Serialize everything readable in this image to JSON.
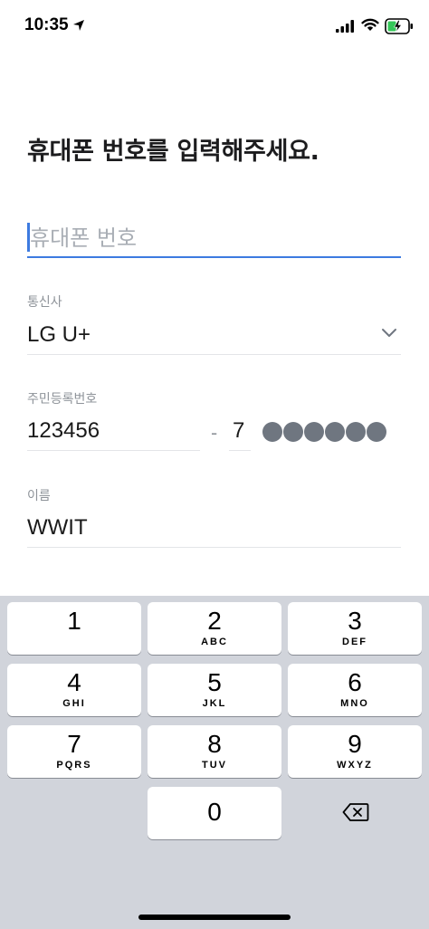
{
  "status_bar": {
    "time": "10:35",
    "icons": [
      "location-arrow-icon",
      "signal-icon",
      "wifi-icon",
      "battery-charging-icon"
    ]
  },
  "page": {
    "title": "휴대폰 번호를 입력해주세요."
  },
  "phone": {
    "placeholder": "휴대폰 번호",
    "value": ""
  },
  "carrier": {
    "label": "통신사",
    "value": "LG U+"
  },
  "resident_number": {
    "label": "주민등록번호",
    "front": "123456",
    "separator": "-",
    "gender_digit": "7",
    "masked_digits": 6
  },
  "name": {
    "label": "이름",
    "value": "WWIT"
  },
  "keypad": {
    "keys": [
      {
        "digit": "1",
        "letters": ""
      },
      {
        "digit": "2",
        "letters": "ABC"
      },
      {
        "digit": "3",
        "letters": "DEF"
      },
      {
        "digit": "4",
        "letters": "GHI"
      },
      {
        "digit": "5",
        "letters": "JKL"
      },
      {
        "digit": "6",
        "letters": "MNO"
      },
      {
        "digit": "7",
        "letters": "PQRS"
      },
      {
        "digit": "8",
        "letters": "TUV"
      },
      {
        "digit": "9",
        "letters": "WXYZ"
      },
      {
        "digit": "0",
        "letters": ""
      }
    ],
    "delete_icon": "backspace-icon"
  },
  "colors": {
    "accent": "#3d7be0",
    "keypad_bg": "#d1d4db",
    "mask_dot": "#6f7680"
  }
}
